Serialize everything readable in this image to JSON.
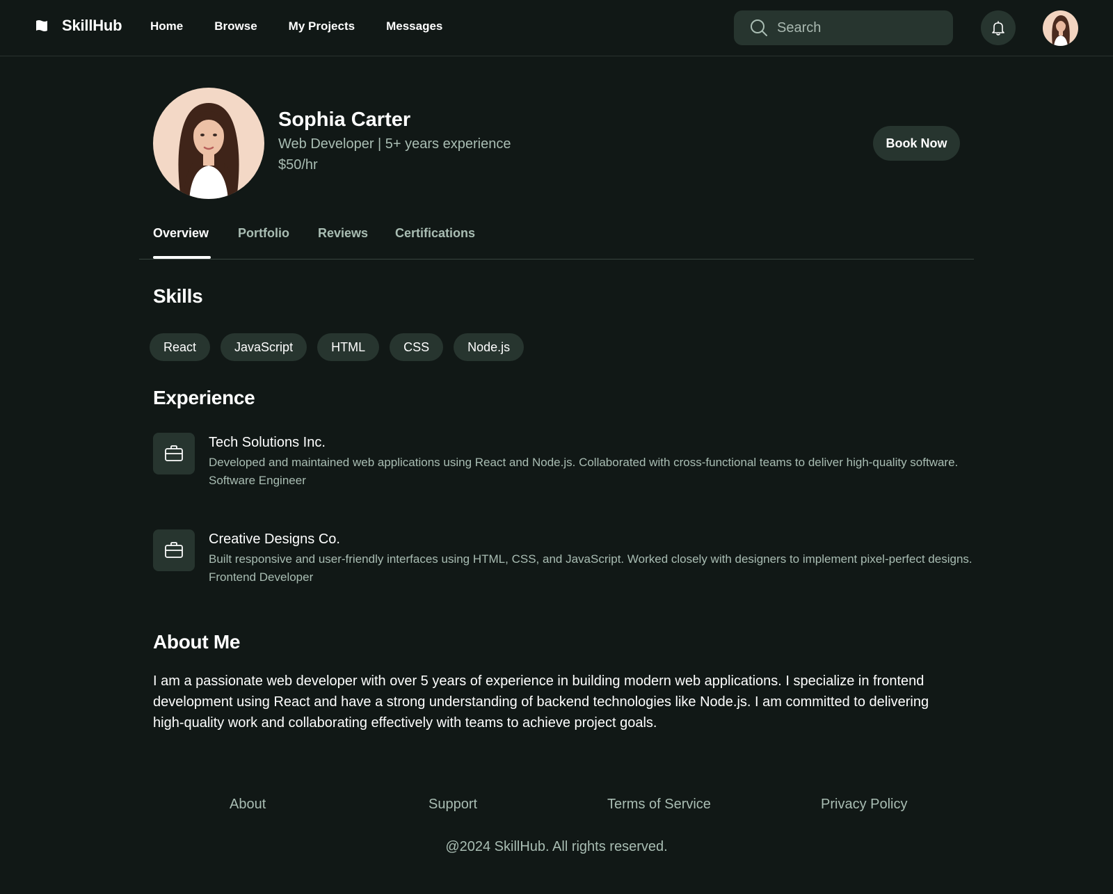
{
  "app": {
    "logo_icon": "flag-icon",
    "name": "SkillHub"
  },
  "nav": {
    "items": [
      "Home",
      "Browse",
      "My Projects",
      "Messages"
    ]
  },
  "search": {
    "placeholder": "Search",
    "icon": "search-icon"
  },
  "header": {
    "notification_icon": "bell-icon",
    "avatar": "user-avatar"
  },
  "profile": {
    "name": "Sophia Carter",
    "role": "Web Developer | 5+ years experience",
    "rate": "$50/hr",
    "book_label": "Book Now"
  },
  "tabs": {
    "items": [
      "Overview",
      "Portfolio",
      "Reviews",
      "Certifications"
    ],
    "active": "Overview"
  },
  "skills": {
    "title": "Skills",
    "items": [
      "React",
      "JavaScript",
      "HTML",
      "CSS",
      "Node.js"
    ]
  },
  "experience": {
    "title": "Experience",
    "items": [
      {
        "company": "Tech Solutions Inc.",
        "description": "Developed and maintained web applications using React and Node.js. Collaborated with cross-functional teams to deliver high-quality software.",
        "title": "Software Engineer",
        "icon": "briefcase-icon"
      },
      {
        "company": "Creative Designs Co.",
        "description": "Built responsive and user-friendly interfaces using HTML, CSS, and JavaScript. Worked closely with designers to implement pixel-perfect designs.",
        "title": "Frontend Developer",
        "icon": "briefcase-icon"
      }
    ]
  },
  "about": {
    "title": "About Me",
    "text": "I am a passionate web developer with over 5 years of experience in building modern web applications. I specialize in frontend development using React and have a strong understanding of backend technologies like Node.js. I am committed to delivering high-quality work and collaborating effectively with teams to achieve project goals."
  },
  "footer": {
    "links": [
      "About",
      "Support",
      "Terms of Service",
      "Privacy Policy"
    ],
    "copyright": "@2024 SkillHub. All rights reserved."
  },
  "colors": {
    "background": "#111816",
    "surface": "#27352f",
    "muted_text": "#a9bdb3",
    "text": "#ffffff"
  }
}
